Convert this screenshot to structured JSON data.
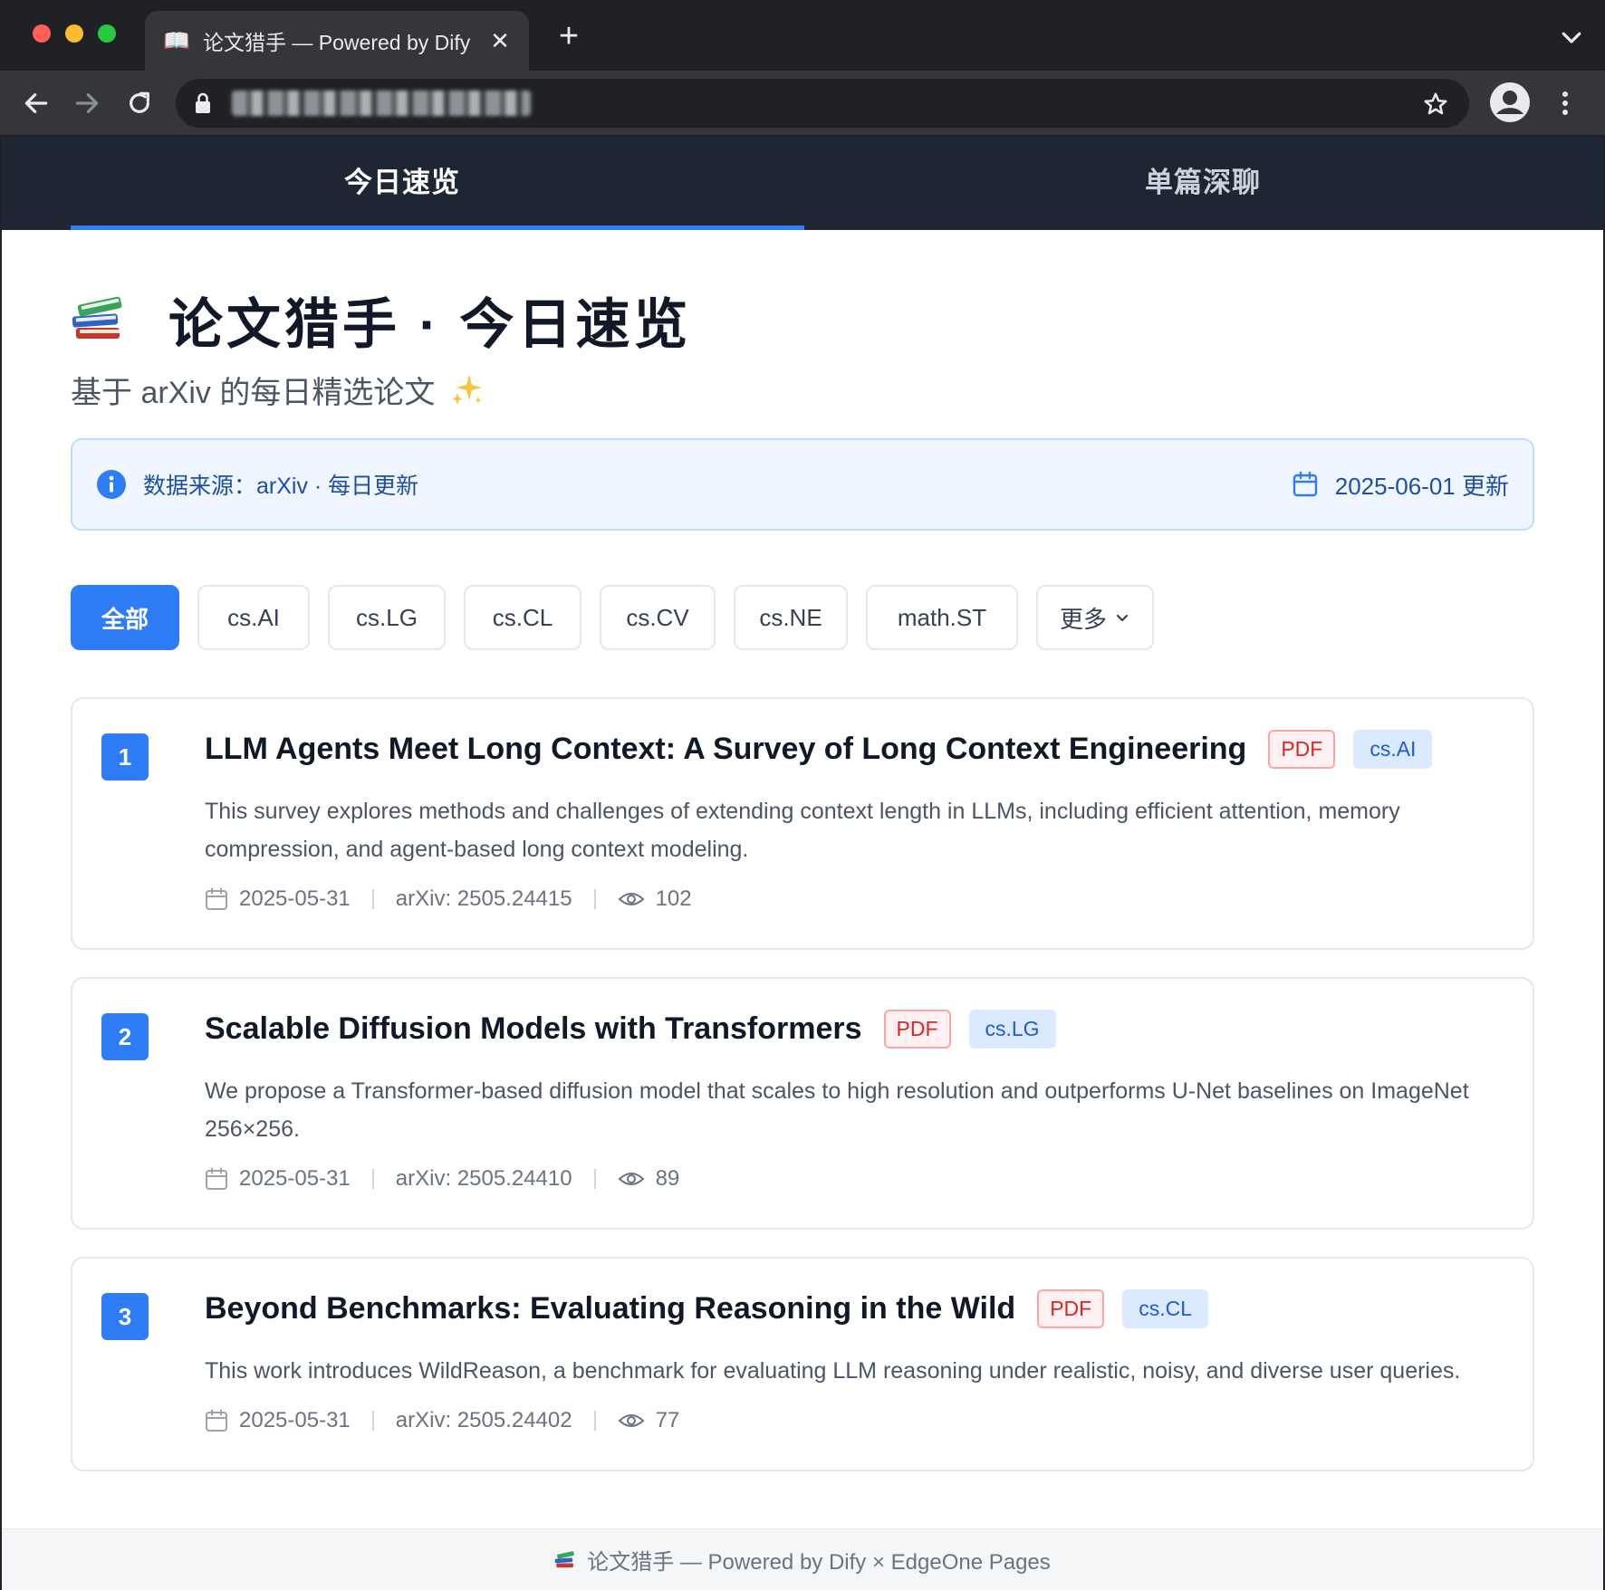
{
  "browser": {
    "tab_title": "论文猎手 — Powered by Dify",
    "tab_favicon": "📖",
    "tab_close": "✕",
    "new_tab": "+"
  },
  "nav": {
    "tabs": [
      {
        "label": "今日速览",
        "active": true
      },
      {
        "label": "单篇深聊",
        "active": false
      }
    ]
  },
  "header": {
    "title": "论文猎手 · 今日速览",
    "subtitle": "基于 arXiv 的每日精选论文"
  },
  "banner": {
    "source_text": "数据来源：arXiv · 每日更新",
    "update_text": "2025-06-01 更新"
  },
  "filters": {
    "chips": [
      "全部",
      "cs.AI",
      "cs.LG",
      "cs.CL",
      "cs.CV",
      "cs.NE",
      "math.ST"
    ],
    "more_label": "更多"
  },
  "papers": [
    {
      "rank": "1",
      "title": "LLM Agents Meet Long Context: A Survey of Long Context Engineering",
      "pdf": "PDF",
      "category": "cs.AI",
      "desc": "This survey explores methods and challenges of extending context length in LLMs, including efficient attention, memory compression, and agent-based long context modeling.",
      "date": "2025-05-31",
      "arxiv": "arXiv: 2505.24415",
      "views": "102"
    },
    {
      "rank": "2",
      "title": "Scalable Diffusion Models with Transformers",
      "pdf": "PDF",
      "category": "cs.LG",
      "desc": "We propose a Transformer-based diffusion model that scales to high resolution and outperforms U-Net baselines on ImageNet 256×256.",
      "date": "2025-05-31",
      "arxiv": "arXiv: 2505.24410",
      "views": "89"
    },
    {
      "rank": "3",
      "title": "Beyond Benchmarks: Evaluating Reasoning in the Wild",
      "pdf": "PDF",
      "category": "cs.CL",
      "desc": "This work introduces WildReason, a benchmark for evaluating LLM reasoning under realistic, noisy, and diverse user queries.",
      "date": "2025-05-31",
      "arxiv": "arXiv: 2505.24402",
      "views": "77"
    }
  ],
  "footer": {
    "text": "论文猎手 — Powered by Dify × EdgeOne Pages"
  },
  "colors": {
    "accent": "#2f7df6",
    "nav_bg": "#1e2633",
    "pdf_red": "#dc2626",
    "banner_bg": "#eff6ff"
  },
  "icons": {
    "page_icon": "books-icon",
    "subtitle_icon": "sparkle-icon",
    "banner_icon": "info-icon",
    "date_icon": "calendar-icon",
    "views_icon": "eye-icon"
  }
}
